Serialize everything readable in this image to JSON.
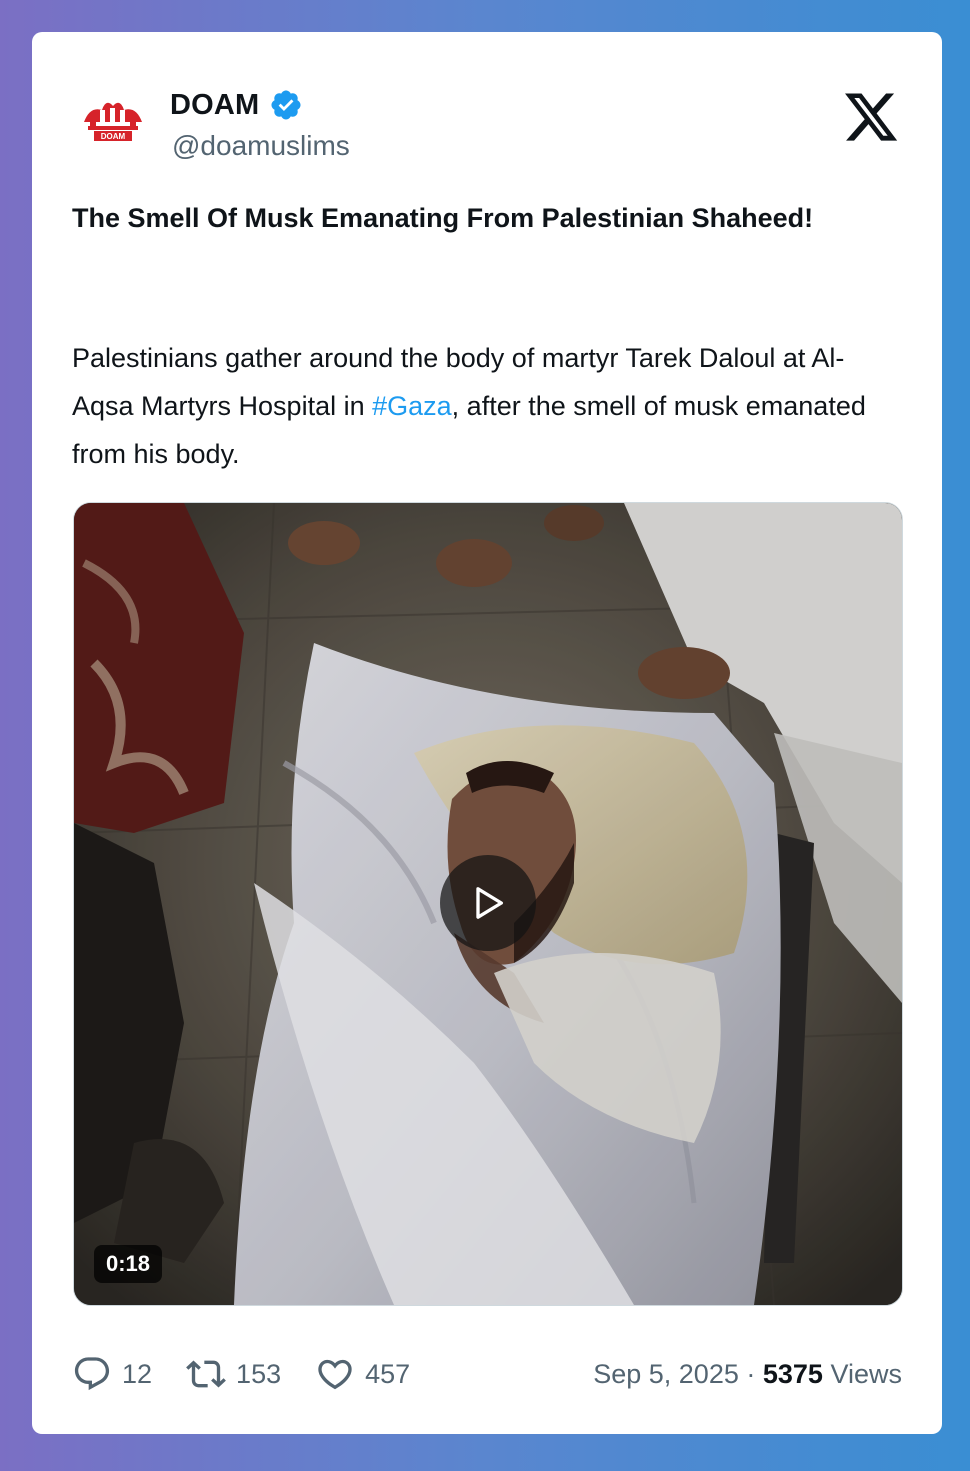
{
  "author": {
    "name": "DOAM",
    "handle": "@doamuslims",
    "logo_text": "DOAM"
  },
  "post": {
    "title": "The Smell Of Musk Emanating From Palestinian Shaheed!",
    "body_before": "Palestinians gather around the body of martyr Tarek Daloul at Al-Aqsa Martyrs Hospital in ",
    "hashtag": "#Gaza",
    "body_after": ", after the smell of musk emanated from his body."
  },
  "video": {
    "duration": "0:18"
  },
  "stats": {
    "replies": "12",
    "retweets": "153",
    "likes": "457"
  },
  "meta": {
    "date": "Sep 5, 2025",
    "separator": " · ",
    "views_count": "5375",
    "views_label": " Views"
  },
  "colors": {
    "accent": "#1d9bf0",
    "verified": "#1d9bf0",
    "text": "#0f1419",
    "muted": "#536471",
    "logo_red": "#d6232a"
  },
  "icons": [
    "verified-badge-icon",
    "x-logo-icon",
    "play-icon",
    "reply-icon",
    "retweet-icon",
    "like-icon"
  ]
}
